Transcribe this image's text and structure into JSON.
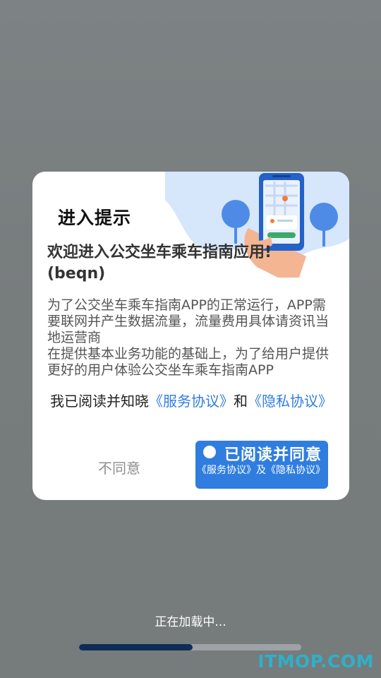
{
  "dialog": {
    "title": "进入提示",
    "welcome": "欢迎进入公交坐车乘车指南应用!(beqn)",
    "body_paragraphs": [
      "为了公交坐车乘车指南APP的正常运行，APP需要联网并产生数据流量，流量费用具体请资讯当地运营商",
      "在提供基本业务功能的基础上，为了给用户提供更好的用户体验公交坐车乘车指南APP"
    ],
    "agree_prefix": "我已阅读并知晓",
    "service_link": "《服务协议》",
    "and_text": "和",
    "privacy_link": "《隐私协议》",
    "disagree_label": "不同意",
    "agree_label": "已阅读并同意",
    "agree_sub": "《服务协议》及《隐私协议》"
  },
  "loading": {
    "text": "正在加载中...",
    "progress": 0.51
  },
  "watermark": "ITMOP.COM",
  "colors": {
    "accent": "#2f7ddf",
    "progress_fill": "#0d2c58",
    "watermark": "#2fb0c9"
  }
}
